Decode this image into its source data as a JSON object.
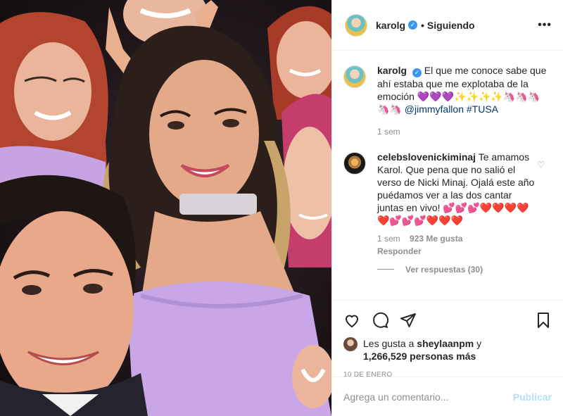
{
  "post": {
    "image": {
      "alt": "",
      "colors": {
        "dress": "#c9a6e8",
        "skin": "#e8b394",
        "hair_dark": "#2b1e1b",
        "hair_red": "#b3442e",
        "background": "#1d1518"
      }
    },
    "header": {
      "username": "karolg",
      "verified_icon": "verified-badge-icon",
      "separator": "•",
      "follow_status": "Siguiendo",
      "more_icon": "•••"
    },
    "caption": {
      "username": "karolg",
      "text_part1": "El que me conoce sabe que ahí estaba que me explotaba de la emoción 💜💜💜✨✨✨✨🦄🦄🦄🦄🦄 ",
      "mention": "@jimmyfallon",
      "hashtag": "#TUSA",
      "time": "1 sem"
    },
    "comment": {
      "username": "celebslovenickiminaj",
      "text": "Te amamos Karol. Que pena que no salió el verso de Nicki Minaj. Ojalá este año puédamos ver a las dos cantar juntas en vivo! 💕💕💕❤️❤️❤️❤️❤️💕💕💕❤️❤️❤️",
      "time": "1 sem",
      "likes": "923 Me gusta",
      "reply": "Responder",
      "view_replies": "Ver respuestas (30)",
      "like_icon": "heart-outline-icon"
    },
    "actions": {
      "like_icon": "heart-icon",
      "comment_icon": "comment-icon",
      "share_icon": "paper-plane-icon",
      "save_icon": "bookmark-icon"
    },
    "likes": {
      "prefix": "Les gusta a ",
      "user": "sheylaanpm",
      "joiner": " y",
      "count": "1,266,529 personas más"
    },
    "date": "10 DE ENERO",
    "add_comment": {
      "placeholder": "Agrega un comentario...",
      "publish": "Publicar"
    }
  }
}
